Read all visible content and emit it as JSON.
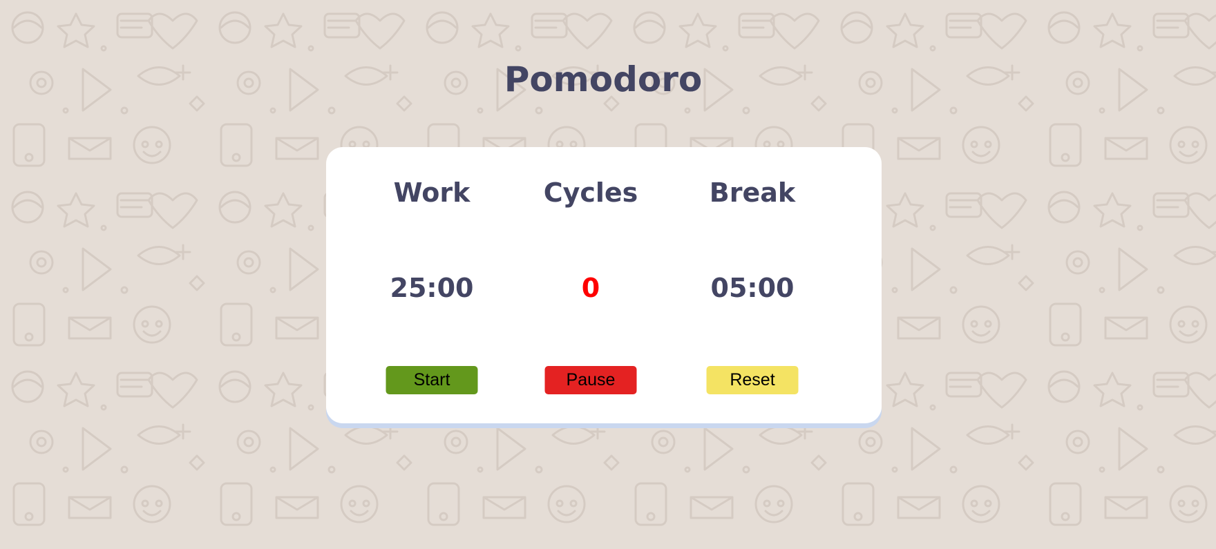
{
  "app": {
    "title": "Pomodoro"
  },
  "columns": [
    {
      "label": "Work",
      "value": "25:00",
      "button": "Start"
    },
    {
      "label": "Cycles",
      "value": "0",
      "button": "Pause"
    },
    {
      "label": "Break",
      "value": "05:00",
      "button": "Reset"
    }
  ],
  "colors": {
    "background": "#e5ddd6",
    "text": "#434563",
    "cycles_value": "#fe0000",
    "start_button": "#63981c",
    "pause_button": "#e42222",
    "reset_button": "#f4e363",
    "card_shadow": "#c9d7ef"
  }
}
